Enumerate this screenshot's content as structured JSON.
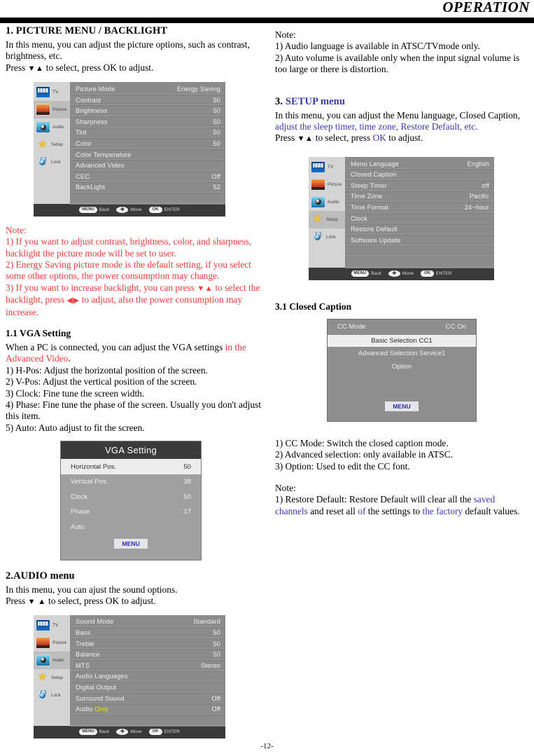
{
  "header": {
    "title": "OPERATION"
  },
  "footer": {
    "page_number": "-12-"
  },
  "left": {
    "s1": {
      "heading": "1. PICTURE MENU / BACKLIGHT",
      "p1": "In this menu, you can adjust the picture options, such as contrast, brightness, etc.",
      "p2_a": "Press ",
      "p2_arrows": "▼▲",
      "p2_b": " to select, press OK to adjust."
    },
    "picture_menu": {
      "sidebar": [
        {
          "label": "TV",
          "icon": "tv-icon",
          "active": false
        },
        {
          "label": "Picture",
          "icon": "picture-icon",
          "active": true
        },
        {
          "label": "Audio",
          "icon": "audio-icon",
          "active": false
        },
        {
          "label": "Setup",
          "icon": "setup-star-icon",
          "active": false
        },
        {
          "label": "Lock",
          "icon": "lock-icon",
          "active": false
        }
      ],
      "rows": [
        {
          "label": "Picture Mode",
          "value": "Energy Saving"
        },
        {
          "label": "Contrast",
          "value": "50"
        },
        {
          "label": "Brightness",
          "value": "50"
        },
        {
          "label": "Sharpness",
          "value": "50"
        },
        {
          "label": "Tint",
          "value": "50"
        },
        {
          "label": "Color",
          "value": "50"
        },
        {
          "label": "Color Temperature",
          "value": ""
        },
        {
          "label": "Advanced Video",
          "value": ""
        },
        {
          "label": "CEC",
          "value": "Off"
        },
        {
          "label": "BackLight",
          "value": "52"
        },
        {
          "label": "",
          "value": ""
        }
      ],
      "footer": {
        "menu": "MENU",
        "back": "Back",
        "dpad": "✚",
        "move": "Move",
        "ok": "OK",
        "enter": "ENTER"
      }
    },
    "note1": {
      "title": "Note:",
      "l1": "1) If you want to adjust contrast, brightness, color, and sharpness, backlight the picture mode will be set to user.",
      "l2": "2) Energy Saving picture mode is the default setting, if you select some other options, the power consumption may change.",
      "l3_a": "3) If you want to increase backlight, you can press ",
      "l3_arrows1": "▼▲",
      "l3_b": " to select the backlight, press ",
      "l3_arrows2": "◀▶",
      "l3_c": " to adjust, also the power consumption may increase."
    },
    "s11": {
      "heading": "1.1 VGA Setting",
      "p1_a": "When a PC is connected, you can adjust the VGA settings ",
      "p1_red": "in the Advanced Video",
      "p1_b": ".",
      "items": [
        "1) H-Pos: Adjust the horizontal position of the screen.",
        "2) V-Pos: Adjust the vertical position of the screen.",
        "3) Clock: Fine tune the screen width.",
        "4) Phase: Fine tune the phase of the screen. Usually  you don't adjust this item.",
        "5) Auto: Auto adjust to fit the screen."
      ]
    },
    "vga_menu": {
      "title": "VGA Setting",
      "rows": [
        {
          "label": "Horizontal Pos.",
          "value": "50",
          "selected": true
        },
        {
          "label": "Vertical Pos.",
          "value": "38",
          "selected": false
        },
        {
          "label": "Clock",
          "value": "50",
          "selected": false
        },
        {
          "label": "Phase",
          "value": "17",
          "selected": false
        },
        {
          "label": "Auto",
          "value": "",
          "selected": false
        }
      ],
      "menu_button": "MENU"
    },
    "s2": {
      "heading": "2.AUDIO menu",
      "p1": "In this menu, you can ajust the sound options.",
      "p2_a": "Press ",
      "p2_arrows": "▼ ▲",
      "p2_b": " to select, press OK to adjust."
    },
    "audio_menu": {
      "sidebar": [
        {
          "label": "TV",
          "icon": "tv-icon",
          "active": false
        },
        {
          "label": "Picture",
          "icon": "picture-icon",
          "active": false
        },
        {
          "label": "Audio",
          "icon": "audio-icon",
          "active": true
        },
        {
          "label": "Setup",
          "icon": "setup-star-icon",
          "active": false
        },
        {
          "label": "Lock",
          "icon": "lock-icon",
          "active": false
        }
      ],
      "rows": [
        {
          "label": "Sound Mode",
          "value": "Standard"
        },
        {
          "label": "Bass",
          "value": "50"
        },
        {
          "label": "Treble",
          "value": "50"
        },
        {
          "label": "Balance",
          "value": "50"
        },
        {
          "label": "MTS",
          "value": "Stereo"
        },
        {
          "label": "Audio Languages",
          "value": ""
        },
        {
          "label": "Digital Output",
          "value": ""
        },
        {
          "label": "Surround Sound",
          "value": "Off"
        },
        {
          "label": "Audio Only",
          "value": "Off",
          "highlight_word": "Only"
        },
        {
          "label": "",
          "value": ""
        }
      ],
      "footer": {
        "menu": "MENU",
        "back": "Back",
        "dpad": "✚",
        "move": "Move",
        "ok": "OK",
        "enter": "ENTER"
      }
    }
  },
  "right": {
    "note_top": {
      "title": "Note:",
      "l1": "1) Audio language is available in ATSC/TVmode only.",
      "l2": "2) Auto volume is available only when the input signal volume is too large or there is distortion."
    },
    "s3": {
      "heading_num": "3. ",
      "heading_blue": "SETUP menu",
      "p1_a": "In this menu, you can adjust the Menu language, Closed Caption, ",
      "p1_blue": "adjust the sleep timer, time zone, Restore Default, etc.",
      "p2_a": "Press ",
      "p2_arrows": "▼▲",
      "p2_b": " to select, press ",
      "p2_blue": "OK",
      "p2_c": " to adjust."
    },
    "setup_menu": {
      "sidebar": [
        {
          "label": "TV",
          "icon": "tv-icon",
          "active": false
        },
        {
          "label": "Picture",
          "icon": "picture-icon",
          "active": false
        },
        {
          "label": "Audio",
          "icon": "audio-icon",
          "active": false
        },
        {
          "label": "Setup",
          "icon": "setup-star-icon",
          "active": true
        },
        {
          "label": "Lock",
          "icon": "lock-icon",
          "active": false
        }
      ],
      "rows": [
        {
          "label": "Menu Language",
          "value": "English"
        },
        {
          "label": "Closed Caption",
          "value": ""
        },
        {
          "label": "Steep Timer",
          "value": "off"
        },
        {
          "label": "Time Zone",
          "value": "Pacific"
        },
        {
          "label": "Time Format",
          "value": "24−hour"
        },
        {
          "label": "Clock",
          "value": ""
        },
        {
          "label": "Restore Default",
          "value": ""
        },
        {
          "label": "Software Update",
          "value": ""
        },
        {
          "label": "",
          "value": ""
        },
        {
          "label": "",
          "value": ""
        }
      ],
      "footer": {
        "menu": "MENU",
        "back": "Back",
        "dpad": "✚",
        "move": "Move",
        "ok": "OK",
        "enter": "ENTER"
      }
    },
    "s31": {
      "heading": "3.1 Closed Caption"
    },
    "cc_menu": {
      "cc_mode_label": "CC Mode",
      "cc_mode_value": "CC On",
      "basic_selection": "Basic Selection CC1",
      "advanced_selection": "Advanced Selection Service1",
      "option": "Option",
      "menu_button": "MENU"
    },
    "cc_items": [
      "1) CC Mode: Switch the closed caption mode.",
      "2) Advanced selection: only available in  ATSC.",
      "3) Option: Used to edit the CC font."
    ],
    "note_bottom": {
      "title": "Note:",
      "l1_a": "1) Restore Default: Restore Default will clear all the ",
      "l1_blue1": "saved channels",
      "l1_b": " and reset all ",
      "l1_blue2": "of",
      "l1_c": " the settings to ",
      "l1_blue3": "the factory",
      "l1_d": " default values."
    }
  },
  "colors": {
    "red": "#ef3b3b",
    "blue": "#3a3ab0",
    "osd_bg": "#8b8b8b",
    "osd_sidebar": "#d4d4d4",
    "highlight": "#ededed",
    "yellow": "#f2e11a"
  }
}
